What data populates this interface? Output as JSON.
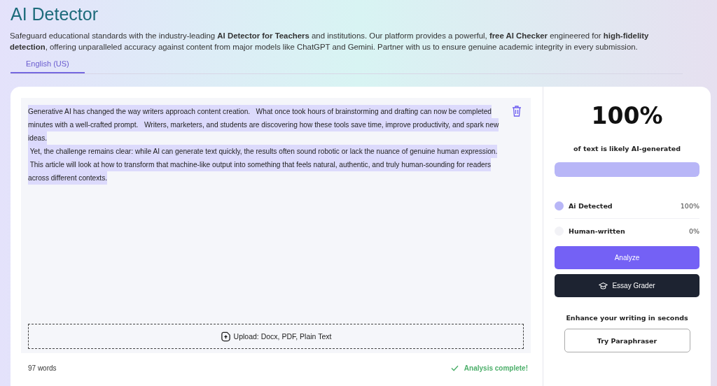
{
  "header": {
    "title": "AI Detector",
    "description": "Safeguard educational standards with the industry-leading **AI Detector for Teachers** and institutions. Our platform provides a powerful, **free AI Checker** engineered for **high-fidelity detection**, offering unparalleled accuracy against content from major models like ChatGPT and Gemini. Partner with us to ensure genuine academic integrity in every submission."
  },
  "tabs": [
    {
      "label": "English (US)",
      "selected": true
    }
  ],
  "editor": {
    "lines": [
      "Generative AI has changed the way writers approach content creation.   What once took hours of brainstorming and drafting can now be completed",
      "minutes with a well-crafted prompt.   Writers, marketers, and students are discovering how these tools save time, improve productivity, and spark new",
      "ideas.",
      " Yet, the challenge remains clear: while AI can generate text quickly, the results often sound robotic or lack the nuance of genuine human expression.",
      " This article will look at how to transform that machine-like output into something that feels natural, authentic, and truly human-sounding for readers",
      "across different contexts."
    ],
    "upload_label": "Upload: Docx, PDF, Plain Text",
    "word_count": "97 words",
    "status": "Analysis complete!"
  },
  "result": {
    "score": "100%",
    "caption": "of text is likely AI-generated",
    "level": 1.0,
    "legend": [
      {
        "label": "Ai Detected",
        "value": "100%",
        "color": "#b8b6f7"
      },
      {
        "label": "Human-written",
        "value": "0%",
        "color": "#f2f2f6"
      }
    ],
    "buttons": [
      {
        "label": "Analyze",
        "kind": "primary"
      },
      {
        "label": "Essay Grader",
        "kind": "dark"
      }
    ],
    "promo": "Enhance your writing in seconds",
    "promo_button": "Try Paraphraser"
  }
}
